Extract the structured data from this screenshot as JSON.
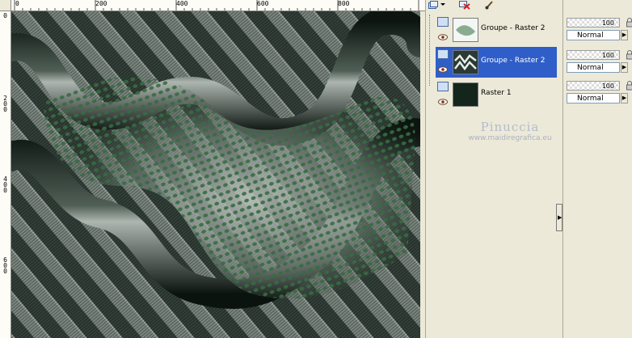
{
  "rulers": {
    "horizontal_labels": [
      "0",
      "200",
      "400",
      "600",
      "800"
    ],
    "vertical_labels": [
      "0",
      "200",
      "400",
      "600"
    ]
  },
  "layers_toolbar": {
    "icons": [
      "new-layer-icon",
      "dropdown-arrow-icon",
      "delete-layer-icon",
      "brush-icon"
    ]
  },
  "layers": [
    {
      "name": "Groupe - Raster 2",
      "selected": false,
      "icon": "layer-group-icon",
      "visible": true
    },
    {
      "name": "Groupe - Raster 2",
      "selected": true,
      "icon": "layer-group-icon",
      "visible": true
    },
    {
      "name": "Raster 1",
      "selected": false,
      "icon": "raster-layer-icon",
      "visible": true
    }
  ],
  "properties": [
    {
      "opacity": "100",
      "blend_mode": "Normal"
    },
    {
      "opacity": "100",
      "blend_mode": "Normal"
    },
    {
      "opacity": "100",
      "blend_mode": "Normal"
    }
  ],
  "watermark": {
    "name": "Pinuccia",
    "url": "www.maidiregrafica.eu"
  },
  "colors": {
    "selection": "#2f5ec9",
    "canvas_dark": "#1d2a22",
    "canvas_stripe": "#7f8a83",
    "dot_green": "#3f7a4a"
  }
}
